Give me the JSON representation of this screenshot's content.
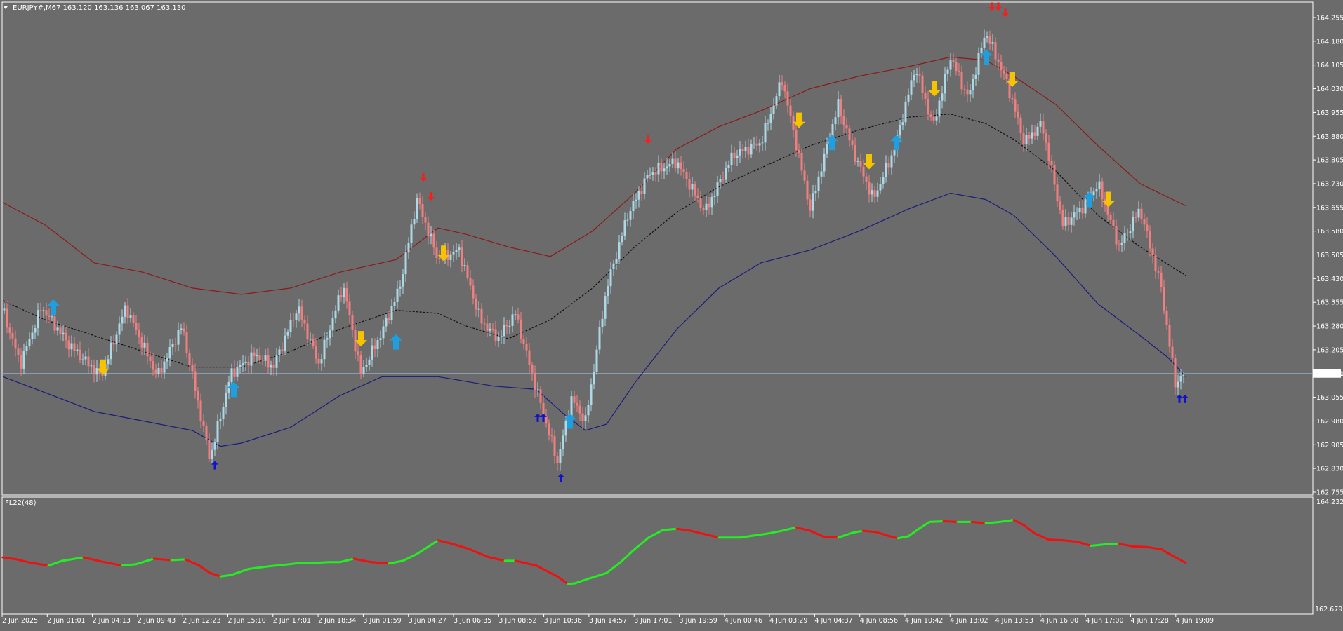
{
  "main_window": {
    "header": "EURJPY#,M67  163.120 163.136 163.067 163.130",
    "menu_icon": "triangle-down-icon",
    "current_price_label": "163.130"
  },
  "indicator_window": {
    "title": "FL22(48)",
    "scale_top": "164.232",
    "scale_bottom": "162.6793"
  },
  "colors": {
    "background": "#6b6b6b",
    "border": "#ffffff",
    "bull_candle": "#add8e6",
    "bear_candle": "#f08080",
    "upper_band": "#8b1a1a",
    "lower_band": "#1c1c7a",
    "mid_line": "#111111",
    "buy_arrow": "#1e9fe0",
    "sell_arrow": "#f5c400",
    "red_signal": "#ff1a1a",
    "blue_signal": "#1010d0",
    "osc_up": "#22ee22",
    "osc_down": "#ee1111",
    "price_line": "#8fb0c8"
  },
  "chart_data": [
    {
      "type": "candlestick",
      "symbol": "EURJPY#",
      "timeframe": "M67",
      "ylim": [
        162.755,
        164.255
      ],
      "y_ticks": [
        "164.255",
        "164.180",
        "164.105",
        "164.030",
        "163.955",
        "163.880",
        "163.805",
        "163.730",
        "163.655",
        "163.580",
        "163.505",
        "163.430",
        "163.355",
        "163.280",
        "163.205",
        "163.130",
        "163.055",
        "162.980",
        "162.905",
        "162.830",
        "162.755"
      ],
      "x_ticks": [
        "2 Jun 2025",
        "2 Jun 01:01",
        "2 Jun 04:13",
        "2 Jun 09:43",
        "2 Jun 12:23",
        "2 Jun 15:10",
        "2 Jun 17:01",
        "2 Jun 18:34",
        "3 Jun 01:59",
        "3 Jun 04:27",
        "3 Jun 06:35",
        "3 Jun 08:52",
        "3 Jun 10:36",
        "3 Jun 14:57",
        "3 Jun 17:01",
        "3 Jun 19:59",
        "4 Jun 00:46",
        "4 Jun 03:29",
        "4 Jun 04:37",
        "4 Jun 08:56",
        "4 Jun 10:42",
        "4 Jun 13:02",
        "4 Jun 13:53",
        "4 Jun 16:00",
        "4 Jun 17:00",
        "4 Jun 17:28",
        "4 Jun 19:09"
      ],
      "current_price": 163.13,
      "price_path": [
        [
          0,
          163.33
        ],
        [
          25,
          163.16
        ],
        [
          55,
          163.34
        ],
        [
          95,
          163.22
        ],
        [
          140,
          163.12
        ],
        [
          175,
          163.34
        ],
        [
          220,
          163.12
        ],
        [
          255,
          163.28
        ],
        [
          295,
          162.86
        ],
        [
          325,
          163.13
        ],
        [
          360,
          163.19
        ],
        [
          385,
          163.15
        ],
        [
          420,
          163.34
        ],
        [
          450,
          163.16
        ],
        [
          485,
          163.41
        ],
        [
          510,
          163.13
        ],
        [
          540,
          163.26
        ],
        [
          565,
          163.4
        ],
        [
          590,
          163.68
        ],
        [
          620,
          163.49
        ],
        [
          650,
          163.52
        ],
        [
          680,
          163.3
        ],
        [
          705,
          163.24
        ],
        [
          730,
          163.32
        ],
        [
          760,
          163.08
        ],
        [
          790,
          162.85
        ],
        [
          810,
          163.05
        ],
        [
          830,
          162.98
        ],
        [
          860,
          163.4
        ],
        [
          890,
          163.63
        ],
        [
          920,
          163.76
        ],
        [
          960,
          163.8
        ],
        [
          1000,
          163.64
        ],
        [
          1040,
          163.82
        ],
        [
          1080,
          163.86
        ],
        [
          1110,
          164.06
        ],
        [
          1150,
          163.65
        ],
        [
          1190,
          163.98
        ],
        [
          1210,
          163.84
        ],
        [
          1240,
          163.68
        ],
        [
          1270,
          163.84
        ],
        [
          1300,
          164.1
        ],
        [
          1325,
          163.91
        ],
        [
          1350,
          164.13
        ],
        [
          1375,
          164.0
        ],
        [
          1400,
          164.21
        ],
        [
          1430,
          164.05
        ],
        [
          1455,
          163.86
        ],
        [
          1480,
          163.92
        ],
        [
          1510,
          163.6
        ],
        [
          1540,
          163.66
        ],
        [
          1560,
          163.73
        ],
        [
          1590,
          163.53
        ],
        [
          1620,
          163.65
        ],
        [
          1650,
          163.4
        ],
        [
          1670,
          163.1
        ],
        [
          1685,
          163.13
        ]
      ],
      "series": [
        {
          "name": "",
          "role": "upper_band",
          "points": [
            [
              0,
              163.67
            ],
            [
              60,
              163.6
            ],
            [
              130,
              163.48
            ],
            [
              200,
              163.45
            ],
            [
              270,
              163.4
            ],
            [
              340,
              163.38
            ],
            [
              410,
              163.4
            ],
            [
              480,
              163.45
            ],
            [
              560,
              163.49
            ],
            [
              620,
              163.59
            ],
            [
              660,
              163.57
            ],
            [
              720,
              163.53
            ],
            [
              780,
              163.5
            ],
            [
              840,
              163.58
            ],
            [
              900,
              163.7
            ],
            [
              960,
              163.84
            ],
            [
              1020,
              163.91
            ],
            [
              1080,
              163.96
            ],
            [
              1150,
              164.03
            ],
            [
              1220,
              164.07
            ],
            [
              1290,
              164.1
            ],
            [
              1350,
              164.13
            ],
            [
              1400,
              164.12
            ],
            [
              1440,
              164.07
            ],
            [
              1500,
              163.98
            ],
            [
              1560,
              163.85
            ],
            [
              1620,
              163.73
            ],
            [
              1685,
              163.66
            ]
          ]
        },
        {
          "name": "",
          "role": "mid_line",
          "points": [
            [
              0,
              163.36
            ],
            [
              60,
              163.3
            ],
            [
              130,
              163.25
            ],
            [
              200,
              163.2
            ],
            [
              270,
              163.15
            ],
            [
              340,
              163.15
            ],
            [
              410,
              163.2
            ],
            [
              480,
              163.27
            ],
            [
              560,
              163.33
            ],
            [
              620,
              163.32
            ],
            [
              660,
              163.28
            ],
            [
              720,
              163.24
            ],
            [
              780,
              163.3
            ],
            [
              840,
              163.4
            ],
            [
              900,
              163.53
            ],
            [
              960,
              163.64
            ],
            [
              1020,
              163.72
            ],
            [
              1080,
              163.78
            ],
            [
              1150,
              163.85
            ],
            [
              1220,
              163.9
            ],
            [
              1290,
              163.94
            ],
            [
              1350,
              163.95
            ],
            [
              1400,
              163.92
            ],
            [
              1440,
              163.87
            ],
            [
              1500,
              163.77
            ],
            [
              1560,
              163.63
            ],
            [
              1620,
              163.53
            ],
            [
              1685,
              163.44
            ]
          ]
        },
        {
          "name": "",
          "role": "lower_band",
          "points": [
            [
              0,
              163.12
            ],
            [
              60,
              163.07
            ],
            [
              130,
              163.01
            ],
            [
              200,
              162.98
            ],
            [
              270,
              162.95
            ],
            [
              310,
              162.9
            ],
            [
              340,
              162.91
            ],
            [
              410,
              162.96
            ],
            [
              480,
              163.06
            ],
            [
              540,
              163.12
            ],
            [
              620,
              163.12
            ],
            [
              700,
              163.09
            ],
            [
              760,
              163.08
            ],
            [
              800,
              163.0
            ],
            [
              830,
              162.95
            ],
            [
              860,
              162.97
            ],
            [
              900,
              163.1
            ],
            [
              960,
              163.27
            ],
            [
              1020,
              163.4
            ],
            [
              1080,
              163.48
            ],
            [
              1150,
              163.52
            ],
            [
              1220,
              163.58
            ],
            [
              1290,
              163.65
            ],
            [
              1350,
              163.7
            ],
            [
              1400,
              163.68
            ],
            [
              1440,
              163.63
            ],
            [
              1500,
              163.5
            ],
            [
              1560,
              163.35
            ],
            [
              1620,
              163.25
            ],
            [
              1660,
              163.18
            ],
            [
              1685,
              163.12
            ]
          ]
        }
      ],
      "signals": [
        {
          "kind": "buy",
          "x": 72,
          "y": 163.34
        },
        {
          "kind": "sell",
          "x": 143,
          "y": 163.15
        },
        {
          "kind": "buy",
          "x": 329,
          "y": 163.08
        },
        {
          "kind": "sell",
          "x": 510,
          "y": 163.24
        },
        {
          "kind": "buy",
          "x": 560,
          "y": 163.23
        },
        {
          "kind": "sell",
          "x": 628,
          "y": 163.51
        },
        {
          "kind": "buy",
          "x": 808,
          "y": 162.98
        },
        {
          "kind": "sell",
          "x": 1134,
          "y": 163.93
        },
        {
          "kind": "buy",
          "x": 1181,
          "y": 163.86
        },
        {
          "kind": "sell",
          "x": 1234,
          "y": 163.8
        },
        {
          "kind": "buy",
          "x": 1273,
          "y": 163.86
        },
        {
          "kind": "sell",
          "x": 1327,
          "y": 164.03
        },
        {
          "kind": "buy",
          "x": 1401,
          "y": 164.13
        },
        {
          "kind": "sell",
          "x": 1438,
          "y": 164.06
        },
        {
          "kind": "buy",
          "x": 1548,
          "y": 163.68
        },
        {
          "kind": "sell",
          "x": 1575,
          "y": 163.68
        },
        {
          "kind": "red_down",
          "x": 599,
          "y": 163.75
        },
        {
          "kind": "red_down",
          "x": 610,
          "y": 163.69
        },
        {
          "kind": "red_down",
          "x": 919,
          "y": 163.87
        },
        {
          "kind": "red_down",
          "x": 1409,
          "y": 164.29
        },
        {
          "kind": "red_down",
          "x": 1418,
          "y": 164.29
        },
        {
          "kind": "red_down",
          "x": 1428,
          "y": 164.27
        },
        {
          "kind": "blue_up",
          "x": 302,
          "y": 162.84
        },
        {
          "kind": "blue_up",
          "x": 762,
          "y": 162.99
        },
        {
          "kind": "blue_up",
          "x": 770,
          "y": 162.99
        },
        {
          "kind": "blue_up",
          "x": 795,
          "y": 162.8
        },
        {
          "kind": "blue_up",
          "x": 1676,
          "y": 163.05
        },
        {
          "kind": "blue_up",
          "x": 1684,
          "y": 163.05
        }
      ]
    },
    {
      "type": "line",
      "title": "FL22(48)",
      "ylim": [
        162.6793,
        164.232
      ],
      "points": [
        [
          0,
          163.43
        ],
        [
          20,
          163.4
        ],
        [
          40,
          163.35
        ],
        [
          65,
          163.31
        ],
        [
          85,
          163.38
        ],
        [
          115,
          163.43
        ],
        [
          140,
          163.37
        ],
        [
          170,
          163.31
        ],
        [
          190,
          163.33
        ],
        [
          215,
          163.41
        ],
        [
          240,
          163.39
        ],
        [
          260,
          163.4
        ],
        [
          280,
          163.31
        ],
        [
          295,
          163.2
        ],
        [
          310,
          163.15
        ],
        [
          325,
          163.17
        ],
        [
          350,
          163.26
        ],
        [
          380,
          163.3
        ],
        [
          400,
          163.32
        ],
        [
          425,
          163.35
        ],
        [
          445,
          163.35
        ],
        [
          465,
          163.36
        ],
        [
          480,
          163.36
        ],
        [
          500,
          163.41
        ],
        [
          525,
          163.36
        ],
        [
          550,
          163.34
        ],
        [
          570,
          163.38
        ],
        [
          590,
          163.48
        ],
        [
          605,
          163.58
        ],
        [
          620,
          163.68
        ],
        [
          640,
          163.63
        ],
        [
          665,
          163.55
        ],
        [
          690,
          163.44
        ],
        [
          715,
          163.38
        ],
        [
          730,
          163.38
        ],
        [
          760,
          163.31
        ],
        [
          790,
          163.15
        ],
        [
          805,
          163.04
        ],
        [
          815,
          163.05
        ],
        [
          835,
          163.12
        ],
        [
          860,
          163.2
        ],
        [
          880,
          163.36
        ],
        [
          900,
          163.55
        ],
        [
          920,
          163.72
        ],
        [
          940,
          163.83
        ],
        [
          960,
          163.85
        ],
        [
          980,
          163.82
        ],
        [
          1000,
          163.77
        ],
        [
          1020,
          163.72
        ],
        [
          1050,
          163.72
        ],
        [
          1070,
          163.75
        ],
        [
          1090,
          163.78
        ],
        [
          1110,
          163.82
        ],
        [
          1130,
          163.87
        ],
        [
          1150,
          163.82
        ],
        [
          1170,
          163.73
        ],
        [
          1190,
          163.72
        ],
        [
          1210,
          163.79
        ],
        [
          1225,
          163.82
        ],
        [
          1245,
          163.8
        ],
        [
          1260,
          163.75
        ],
        [
          1275,
          163.71
        ],
        [
          1290,
          163.74
        ],
        [
          1305,
          163.85
        ],
        [
          1320,
          163.95
        ],
        [
          1340,
          163.96
        ],
        [
          1360,
          163.95
        ],
        [
          1380,
          163.95
        ],
        [
          1400,
          163.93
        ],
        [
          1420,
          163.95
        ],
        [
          1440,
          163.98
        ],
        [
          1455,
          163.9
        ],
        [
          1470,
          163.78
        ],
        [
          1490,
          163.69
        ],
        [
          1510,
          163.68
        ],
        [
          1530,
          163.66
        ],
        [
          1550,
          163.6
        ],
        [
          1570,
          163.62
        ],
        [
          1590,
          163.63
        ],
        [
          1610,
          163.59
        ],
        [
          1630,
          163.58
        ],
        [
          1650,
          163.55
        ],
        [
          1665,
          163.46
        ],
        [
          1685,
          163.35
        ]
      ],
      "colored_by_slope": true
    }
  ]
}
